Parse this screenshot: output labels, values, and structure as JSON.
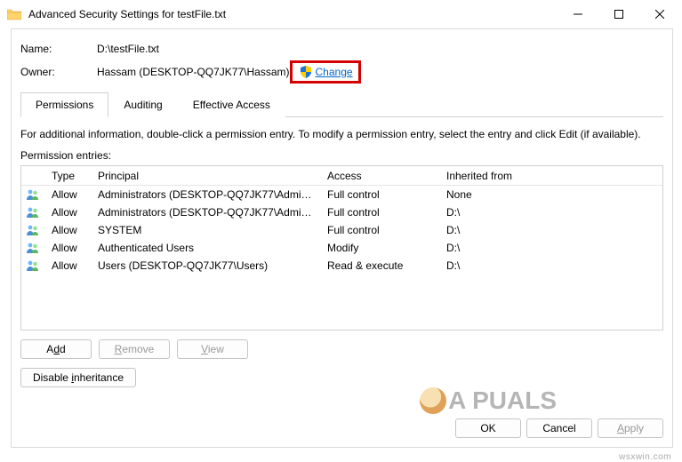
{
  "window": {
    "title": "Advanced Security Settings for testFile.txt"
  },
  "fields": {
    "name_label": "Name:",
    "name_value": "D:\\testFile.txt",
    "owner_label": "Owner:",
    "owner_value": "Hassam (DESKTOP-QQ7JK77\\Hassam)",
    "change_label": "Change"
  },
  "tabs": {
    "permissions": "Permissions",
    "auditing": "Auditing",
    "effective": "Effective Access"
  },
  "info_text": "For additional information, double-click a permission entry. To modify a permission entry, select the entry and click Edit (if available).",
  "entries_label": "Permission entries:",
  "columns": {
    "type": "Type",
    "principal": "Principal",
    "access": "Access",
    "inherited": "Inherited from"
  },
  "rows": [
    {
      "type": "Allow",
      "principal": "Administrators (DESKTOP-QQ7JK77\\Admini...",
      "access": "Full control",
      "inherited": "None"
    },
    {
      "type": "Allow",
      "principal": "Administrators (DESKTOP-QQ7JK77\\Admini...",
      "access": "Full control",
      "inherited": "D:\\"
    },
    {
      "type": "Allow",
      "principal": "SYSTEM",
      "access": "Full control",
      "inherited": "D:\\"
    },
    {
      "type": "Allow",
      "principal": "Authenticated Users",
      "access": "Modify",
      "inherited": "D:\\"
    },
    {
      "type": "Allow",
      "principal": "Users (DESKTOP-QQ7JK77\\Users)",
      "access": "Read & execute",
      "inherited": "D:\\"
    }
  ],
  "buttons": {
    "add": "Add",
    "remove": "Remove",
    "view": "View",
    "disable_inheritance": "Disable inheritance",
    "ok": "OK",
    "cancel": "Cancel",
    "apply": "Apply"
  },
  "watermark": "A PUALS",
  "source_mark": "wsxwin.com"
}
